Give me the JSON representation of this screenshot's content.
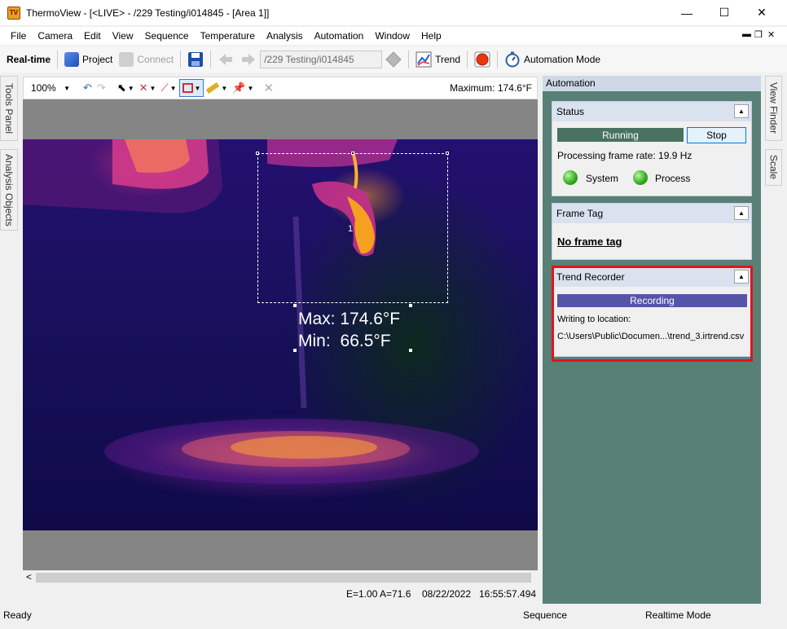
{
  "window": {
    "app_icon_text": "TV",
    "title": "ThermoView - [<LIVE> - /229 Testing/i014845 - [Area 1]]",
    "minimize": "—",
    "maximize": "☐",
    "close": "✕"
  },
  "menu": [
    "File",
    "Camera",
    "Edit",
    "View",
    "Sequence",
    "Temperature",
    "Analysis",
    "Automation",
    "Window",
    "Help"
  ],
  "mdi": {
    "minimize": "▬",
    "restore": "❐",
    "close": "✕"
  },
  "toolbar": {
    "mode": "Real-time",
    "project": "Project",
    "connect": "Connect",
    "path": "/229 Testing/i014845",
    "trend": "Trend",
    "automation_mode": "Automation Mode"
  },
  "left_tabs": [
    "Tools Panel",
    "Analysis Objects"
  ],
  "right_tabs": [
    "View Finder",
    "Scale"
  ],
  "image_toolbar": {
    "zoom": "100%",
    "maximum": "Maximum: 174.6°F"
  },
  "image": {
    "roi_number": "1",
    "max_label": "Max:",
    "max_value": "174.6°F",
    "min_label": "Min:",
    "min_value": "66.5°F",
    "scroll_left": "<",
    "emissivity": "E=1.00 A=71.6",
    "date": "08/22/2022",
    "time": "16:55:57.494"
  },
  "automation": {
    "header": "Automation",
    "status": {
      "title": "Status",
      "running": "Running",
      "stop": "Stop",
      "frame_rate": "Processing frame rate: 19.9 Hz",
      "system": "System",
      "process": "Process"
    },
    "frame_tag": {
      "title": "Frame Tag",
      "value": "No frame tag"
    },
    "trend_recorder": {
      "title": "Trend Recorder",
      "recording": "Recording",
      "writing_label": "Writing to location:",
      "path": "C:\\Users\\Public\\Documen...\\trend_3.irtrend.csv"
    }
  },
  "statusbar": {
    "left": "Ready",
    "middle": "Sequence",
    "right": "Realtime Mode"
  }
}
